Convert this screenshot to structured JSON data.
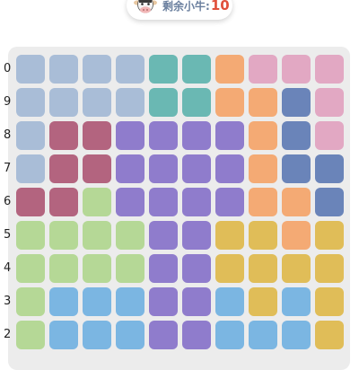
{
  "counter": {
    "label": "剩余小牛:",
    "value": "10",
    "icon": "cow-head-icon"
  },
  "board": {
    "row_labels": [
      "0",
      "9",
      "8",
      "7",
      "6",
      "5",
      "4",
      "3",
      "2"
    ],
    "palette": {
      "S": "#a9bdd7",
      "T": "#6ab8b3",
      "O": "#f4aa74",
      "P": "#e2a8c3",
      "B": "#6a84b9",
      "M": "#b3647f",
      "V": "#8f7ccc",
      "G": "#b5d896",
      "Y": "#e0bd58",
      "L": "#7bb6e2"
    },
    "rows": [
      "SSSSTTOPPP",
      "SSSSTTOOBP",
      "SMMVVVVOBP",
      "SMMVVVVOBB",
      "MMGVVVVOOB",
      "GGGGVVYYOY",
      "GGGGVVYYYY",
      "GLLLVVLYLY",
      "GLLLVVLLLY"
    ]
  }
}
